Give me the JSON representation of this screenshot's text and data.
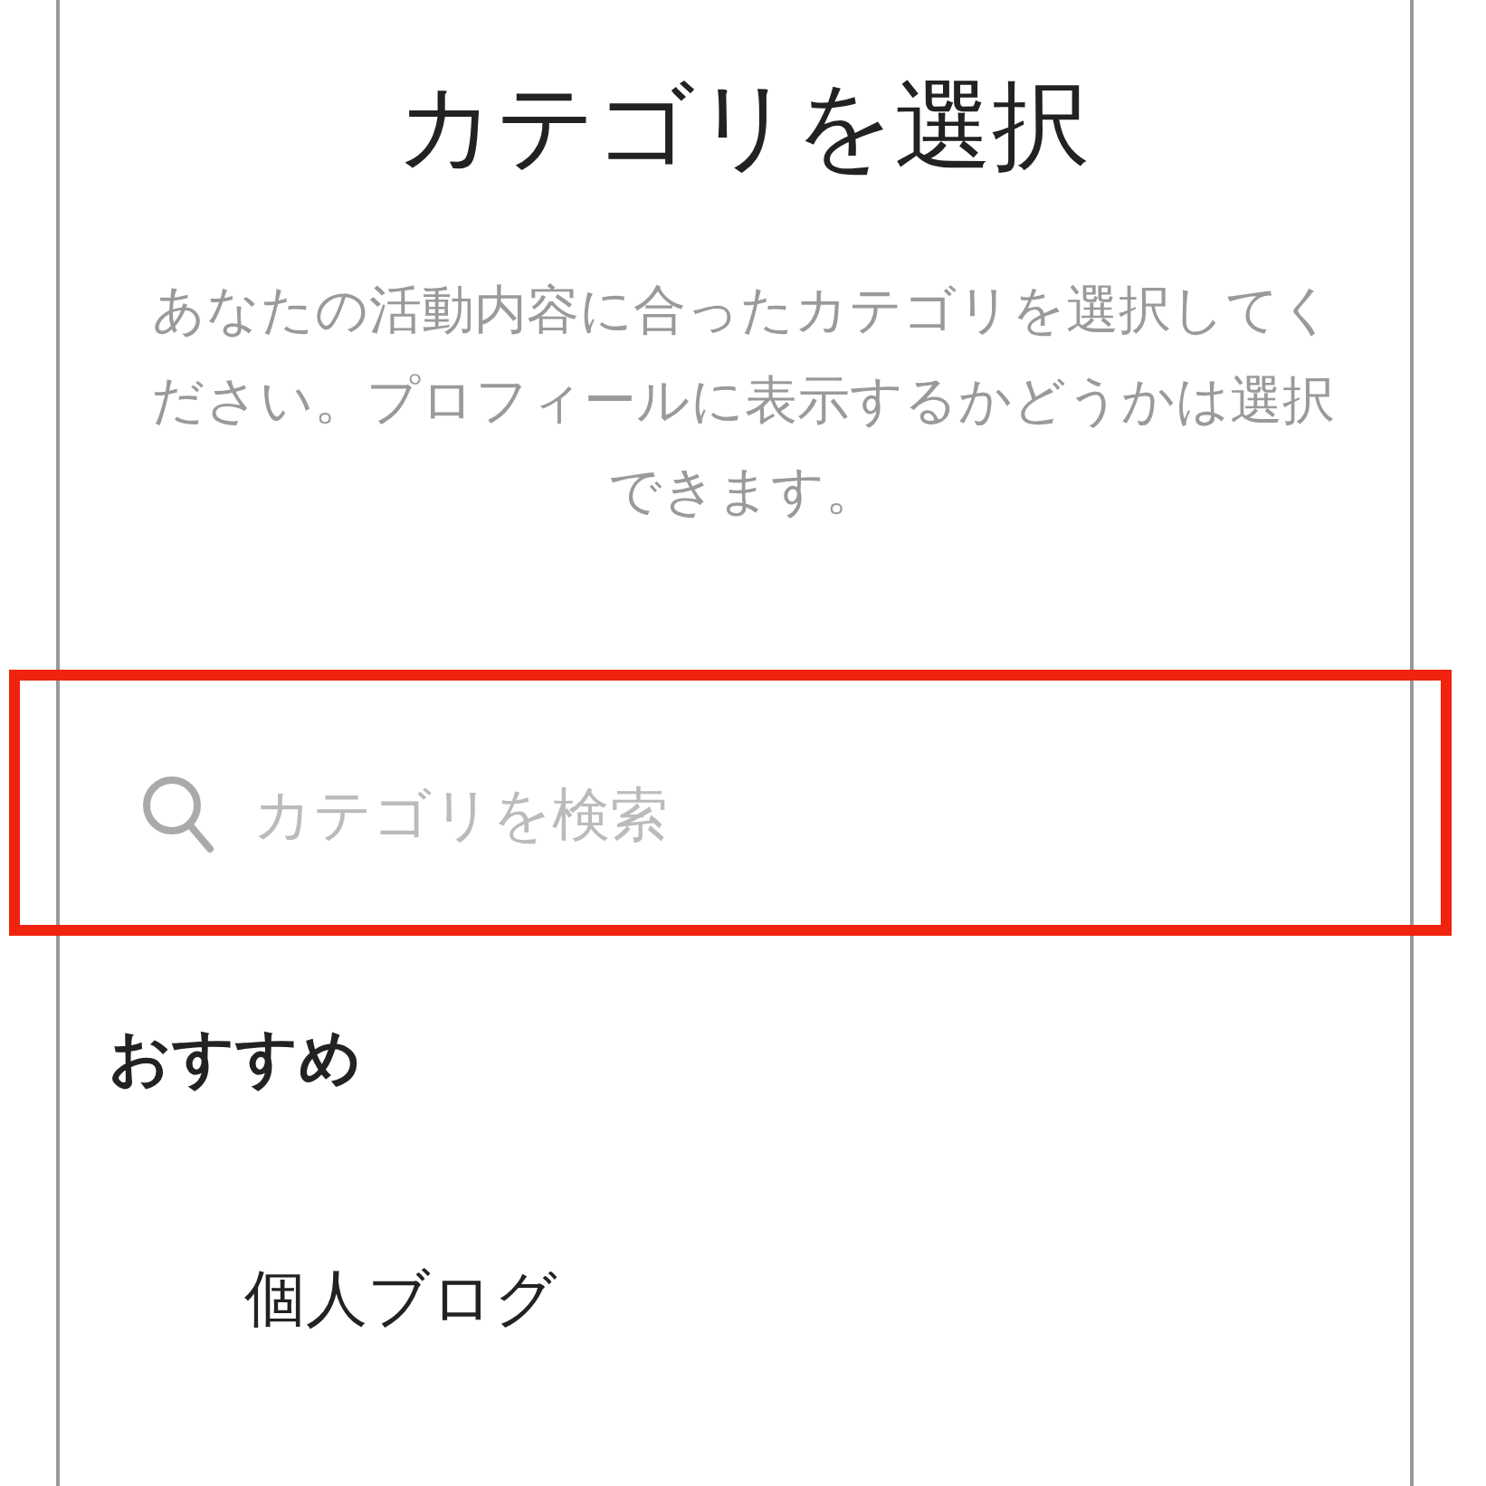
{
  "title": "カテゴリを選択",
  "description": "あなたの活動内容に合ったカテゴリを選択してください。プロフィールに表示するかどうかは選択できます。",
  "search": {
    "placeholder": "カテゴリを検索"
  },
  "section_title": "おすすめ",
  "items": [
    {
      "label": "個人ブログ"
    }
  ]
}
